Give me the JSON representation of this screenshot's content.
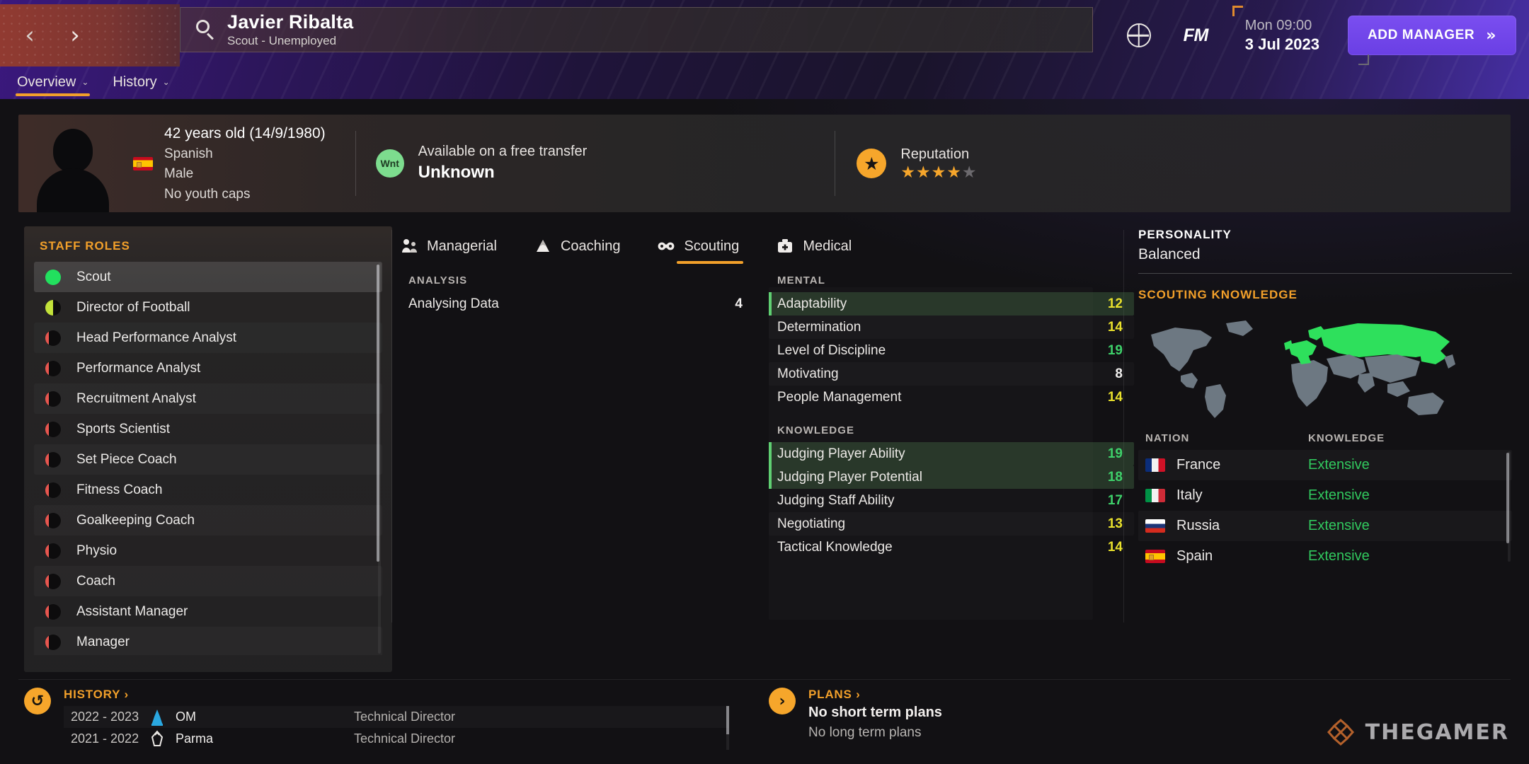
{
  "header": {
    "back_label": "‹",
    "forward_label": "›",
    "search_icon": "search-icon",
    "person_name": "Javier Ribalta",
    "person_subtitle": "Scout - Unemployed",
    "globe_icon": "globe-icon",
    "fm_logo": "FM",
    "time": "Mon 09:00",
    "date": "3 Jul 2023",
    "add_manager_label": "ADD MANAGER",
    "add_manager_chevron": "»",
    "accent_orange": "#f2a02a",
    "accent_purple": "#6a3fe4"
  },
  "subtabs": [
    {
      "label": "Overview",
      "caret": "⌄",
      "active": true
    },
    {
      "label": "History",
      "caret": "⌄",
      "active": false
    }
  ],
  "profile": {
    "avatar_icon": "avatar-silhouette",
    "nationality_flag": "flag-spain",
    "age_line": "42 years old (14/9/1980)",
    "nationality": "Spanish",
    "gender": "Male",
    "caps": "No youth caps",
    "contract_badge": "Wnt",
    "contract_status": "Available on a free transfer",
    "contract_value": "Unknown",
    "reputation_icon": "star-badge-icon",
    "reputation_label": "Reputation",
    "reputation_stars_filled": 4,
    "reputation_stars_total": 5
  },
  "staff_roles": {
    "title": "STAFF ROLES",
    "items": [
      {
        "label": "Scout",
        "suitability": "full",
        "color": "#22e05e",
        "selected": true
      },
      {
        "label": "Director of Football",
        "suitability": "half",
        "color": "#c3e23a",
        "selected": false
      },
      {
        "label": "Head Performance Analyst",
        "suitability": "sliver",
        "color": "#e8564f",
        "selected": false
      },
      {
        "label": "Performance Analyst",
        "suitability": "sliver",
        "color": "#e8564f",
        "selected": false
      },
      {
        "label": "Recruitment Analyst",
        "suitability": "sliver",
        "color": "#e8564f",
        "selected": false
      },
      {
        "label": "Sports Scientist",
        "suitability": "sliver",
        "color": "#e8564f",
        "selected": false
      },
      {
        "label": "Set Piece Coach",
        "suitability": "sliver",
        "color": "#e8564f",
        "selected": false
      },
      {
        "label": "Fitness Coach",
        "suitability": "sliver",
        "color": "#e8564f",
        "selected": false
      },
      {
        "label": "Goalkeeping Coach",
        "suitability": "sliver",
        "color": "#e8564f",
        "selected": false
      },
      {
        "label": "Physio",
        "suitability": "sliver",
        "color": "#e8564f",
        "selected": false
      },
      {
        "label": "Coach",
        "suitability": "sliver",
        "color": "#e8564f",
        "selected": false
      },
      {
        "label": "Assistant Manager",
        "suitability": "sliver",
        "color": "#e8564f",
        "selected": false
      },
      {
        "label": "Manager",
        "suitability": "sliver",
        "color": "#e8564f",
        "selected": false
      }
    ]
  },
  "attribute_tabs": [
    {
      "label": "Managerial",
      "icon": "managerial-icon",
      "active": false
    },
    {
      "label": "Coaching",
      "icon": "coaching-icon",
      "active": false
    },
    {
      "label": "Scouting",
      "icon": "binoculars-icon",
      "active": true
    },
    {
      "label": "Medical",
      "icon": "medical-kit-icon",
      "active": false
    }
  ],
  "attributes": {
    "analysis": {
      "heading": "ANALYSIS",
      "rows": [
        {
          "name": "Analysing Data",
          "value": "4",
          "tone": "white",
          "highlight": false
        }
      ]
    },
    "mental": {
      "heading": "MENTAL",
      "rows": [
        {
          "name": "Adaptability",
          "value": "12",
          "tone": "yellow",
          "highlight": true
        },
        {
          "name": "Determination",
          "value": "14",
          "tone": "yellow",
          "highlight": false
        },
        {
          "name": "Level of Discipline",
          "value": "19",
          "tone": "green",
          "highlight": false
        },
        {
          "name": "Motivating",
          "value": "8",
          "tone": "white",
          "highlight": false
        },
        {
          "name": "People Management",
          "value": "14",
          "tone": "yellow",
          "highlight": false
        }
      ]
    },
    "knowledge": {
      "heading": "KNOWLEDGE",
      "rows": [
        {
          "name": "Judging Player Ability",
          "value": "19",
          "tone": "green",
          "highlight": true
        },
        {
          "name": "Judging Player Potential",
          "value": "18",
          "tone": "green",
          "highlight": true
        },
        {
          "name": "Judging Staff Ability",
          "value": "17",
          "tone": "green",
          "highlight": false
        },
        {
          "name": "Negotiating",
          "value": "13",
          "tone": "yellow",
          "highlight": false
        },
        {
          "name": "Tactical Knowledge",
          "value": "14",
          "tone": "yellow",
          "highlight": false
        }
      ]
    }
  },
  "right_panel": {
    "personality_title": "PERSONALITY",
    "personality_value": "Balanced",
    "scouting_title": "SCOUTING KNOWLEDGE",
    "map_icon": "world-map",
    "map_highlight_color": "#2ee05c",
    "map_base_color": "#6d7882",
    "nation_header": {
      "nation": "NATION",
      "knowledge": "KNOWLEDGE"
    },
    "nations": [
      {
        "name": "France",
        "flag": "flag-france",
        "knowledge": "Extensive"
      },
      {
        "name": "Italy",
        "flag": "flag-italy",
        "knowledge": "Extensive"
      },
      {
        "name": "Russia",
        "flag": "flag-russia",
        "knowledge": "Extensive"
      },
      {
        "name": "Spain",
        "flag": "flag-spain",
        "knowledge": "Extensive"
      }
    ]
  },
  "history": {
    "icon": "history-arrow-icon",
    "link_label": "HISTORY ›",
    "rows": [
      {
        "years": "2022 - 2023",
        "club": "OM",
        "badge": "om-badge",
        "role": "Technical Director"
      },
      {
        "years": "2021 - 2022",
        "club": "Parma",
        "badge": "parma-badge",
        "role": "Technical Director"
      }
    ]
  },
  "plans": {
    "icon": "chevron-right-icon",
    "link_label": "PLANS ›",
    "short_term": "No short term plans",
    "long_term": "No long term plans"
  },
  "watermark": {
    "text": "THEGAMER",
    "icon": "thegamer-logo"
  }
}
